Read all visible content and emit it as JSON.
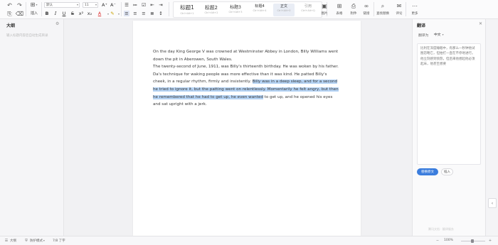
{
  "toolbar": {
    "font_name": "默认",
    "font_size": "11",
    "insert_label": "插入",
    "styles": [
      {
        "name": "标题1",
        "shortcut": "Ctrl+Alt+1"
      },
      {
        "name": "标题2",
        "shortcut": "Ctrl+Alt+2"
      },
      {
        "name": "标题3",
        "shortcut": "Ctrl+Alt+3"
      },
      {
        "name": "标题4",
        "shortcut": "Ctrl+Alt+4"
      },
      {
        "name": "正文",
        "shortcut": "Ctrl+Alt+0"
      },
      {
        "name": "引用",
        "shortcut": "Ctrl+Alt+Q"
      }
    ],
    "buttons": [
      "图片",
      "表格",
      "附件",
      "链接",
      "查找替换",
      "评论",
      "更多"
    ]
  },
  "outline": {
    "title": "大纲",
    "empty_hint": "输入标题内容后自动生成目录"
  },
  "document": {
    "paragraphs": [
      {
        "text": "On the day King George V was crowned at Westminster Abbey in London, Billy Williams went down the pit in Aberowen, South Wales."
      },
      {
        "before": "The twenty-second of June, 1911, was Billy's thirteenth birthday. He was woken by his father. Da's technique for waking people was more effective than it was kind. He patted Billy's cheek, in a regular rhythm, firmly and insistently. ",
        "selected": "Billy was in a deep sleep, and for a second he tried to ignore it, but the patting went on relentlessly. Momentarily he felt angry, but then he remembered that he had to get up, he even wanted",
        "after": " to get up, and he opened his eyes and sat upright with a jerk."
      }
    ]
  },
  "translate": {
    "title": "翻译",
    "to_label": "翻译为",
    "target_lang": "中文",
    "result": "比利在深度睡眠中，有那么一秒钟他试图忽略它，但拍打一直在不停地进行。他立刻感到愤怒，但后来他想起他必须起床，他甚至想要",
    "replace_btn": "替换原文",
    "insert_btn": "插入",
    "watermark": "腾讯文档 · 翻译服务"
  },
  "status": {
    "outline_toggle": "大纲",
    "protect": "防护模式",
    "page_info": "7/8 了字",
    "zoom": "100%"
  },
  "colors": {
    "selection": "#b6d4f5",
    "accent": "#3b7ddd"
  }
}
